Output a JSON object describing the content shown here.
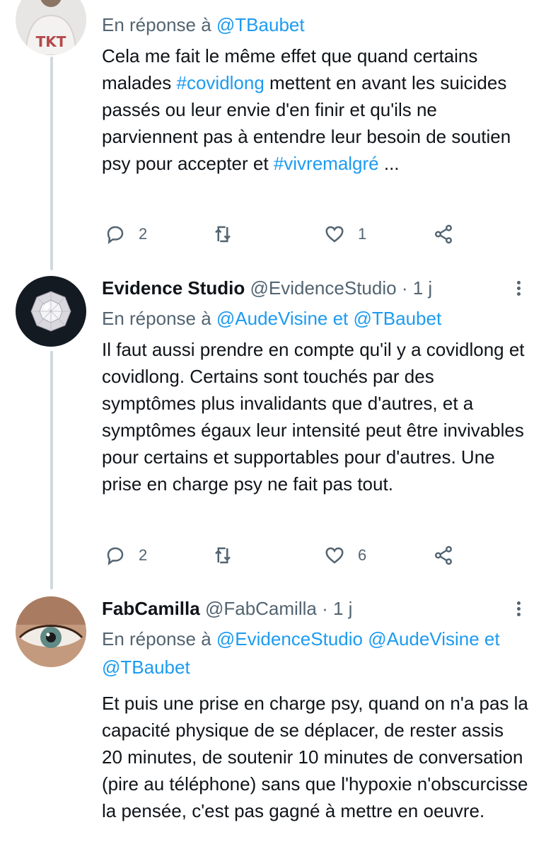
{
  "tweets": [
    {
      "reply_prefix": "En réponse à",
      "reply_handle": "@TBaubet",
      "body": {
        "t1": "Cela me fait le même effet que quand certains malades ",
        "hashtag1": "#covidlong",
        "t2": " mettent en avant les suicides passés ou leur envie d'en finir et qu'ils ne parviennent pas à entendre leur besoin de soutien psy pour accepter et ",
        "hashtag2": "#vivremalgré",
        "t3": " ..."
      },
      "replies": "2",
      "retweets": "",
      "likes": "1"
    },
    {
      "name": "Evidence Studio",
      "handle": "@EvidenceStudio",
      "time": "· 1 j",
      "reply_prefix": "En réponse à",
      "reply_to": "@AudeVisine et @TBaubet",
      "body": "Il faut aussi prendre en compte qu'il y a covidlong et covidlong. Certains sont touchés par des symptômes plus invalidants que d'autres, et a symptômes égaux leur intensité peut être invivables pour certains et supportables pour d'autres. Une prise en charge psy ne fait pas tout.",
      "replies": "2",
      "retweets": "",
      "likes": "6"
    },
    {
      "name": "FabCamilla",
      "handle": "@FabCamilla",
      "time": "· 1 j",
      "reply_prefix": "En réponse à",
      "reply_to": "@EvidenceStudio @AudeVisine et @TBaubet",
      "body": "Et puis une prise en charge psy, quand on n'a pas la capacité physique de se déplacer, de rester assis 20 minutes, de soutenir 10 minutes de conversation (pire au téléphone) sans que l'hypoxie n'obscurcisse la pensée, c'est pas gagné à mettre en oeuvre."
    }
  ],
  "icons": [
    "reply-icon",
    "retweet-icon",
    "like-icon",
    "share-icon",
    "more-icon"
  ],
  "colors": {
    "link": "#1d9bf0",
    "muted": "#536471",
    "text": "#0f1419",
    "thread": "#cfd9de"
  }
}
